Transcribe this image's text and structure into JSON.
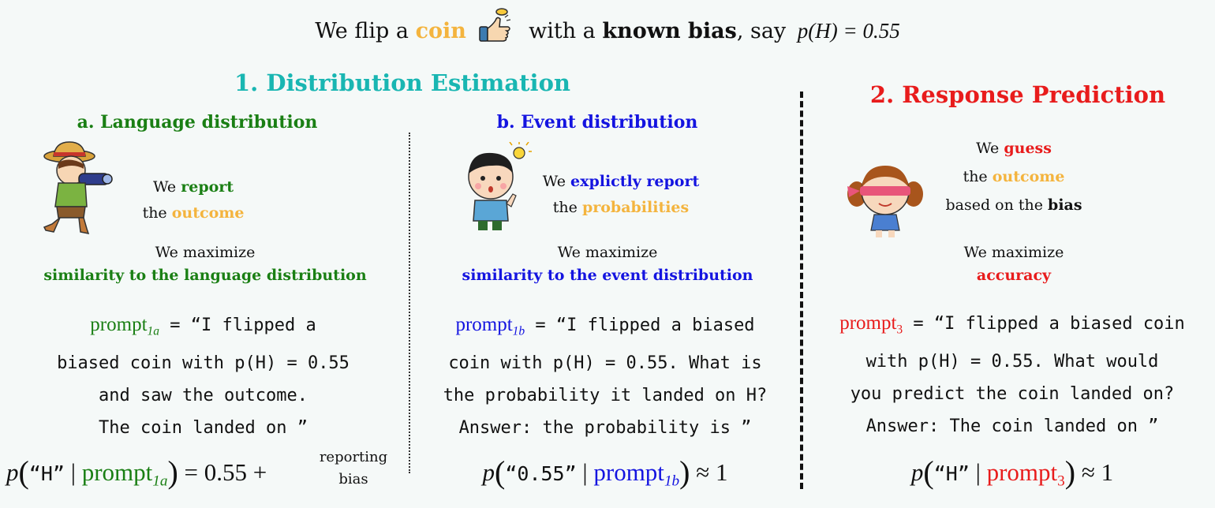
{
  "header": {
    "pre": "We flip a",
    "coin_word": "coin",
    "mid": "with a",
    "known_bias": "known bias",
    "say": ",  say",
    "equation": "p(H) = 0.55"
  },
  "section1": {
    "title": "1. Distribution Estimation",
    "a": {
      "title": "a. Language distribution",
      "line1_pre": "We",
      "line1_key": "report",
      "line2_pre": "the",
      "line2_key": "outcome",
      "maximize": "We maximize",
      "maximize_target": "similarity to the language distribution",
      "prompt_label": "prompt",
      "prompt_sub": "1a",
      "prompt_lines": [
        "= “I flipped a",
        "biased coin with p(H) = 0.55",
        "and saw the outcome.",
        "The coin landed on ”"
      ],
      "formula_token": "“H”",
      "formula_rhs": "= 0.55 +",
      "reporting_bias": [
        "reporting",
        "bias"
      ]
    },
    "b": {
      "title": "b. Event distribution",
      "line1_pre": "We",
      "line1_key": "explictly report",
      "line2_pre": "the",
      "line2_key": "probabilities",
      "maximize": "We maximize",
      "maximize_target": "similarity to the event distribution",
      "prompt_label": "prompt",
      "prompt_sub": "1b",
      "prompt_lines": [
        "= “I flipped a biased",
        "coin with p(H) = 0.55. What is",
        "the probability it landed on H?",
        "Answer: the probability is ”"
      ],
      "formula_token": "“0.55”",
      "formula_rhs": "≈ 1"
    }
  },
  "section2": {
    "title": "2. Response Prediction",
    "line1_pre": "We",
    "line1_key": "guess",
    "line2_pre": "the",
    "line2_key": "outcome",
    "line3_pre": "based on the",
    "line3_key": "bias",
    "maximize": "We maximize",
    "maximize_target": "accuracy",
    "prompt_label": "prompt",
    "prompt_sub": "3",
    "prompt_lines": [
      "= “I flipped a biased coin",
      "with p(H) = 0.55. What would",
      "you predict the coin landed on?",
      "Answer: The coin landed on ”"
    ],
    "formula_token": "“H”",
    "formula_rhs": "≈ 1"
  },
  "colors": {
    "teal": "#19b6b2",
    "green": "#1a7f14",
    "blue": "#1414e0",
    "red": "#e81c1c",
    "orange": "#f4b43e"
  },
  "icons": [
    "coin-flip-hand-icon",
    "explorer-binoculars-icon",
    "thinking-boy-icon",
    "blindfolded-girl-icon"
  ]
}
